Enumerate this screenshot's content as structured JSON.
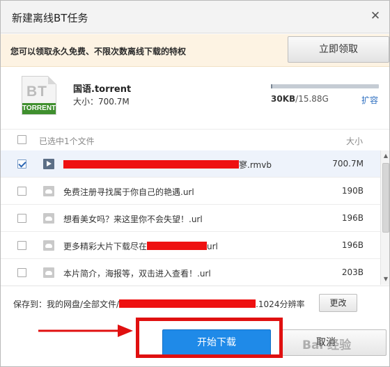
{
  "dialog": {
    "title": "新建离线BT任务",
    "close_icon": "close-icon"
  },
  "promo": {
    "text": "您可以领取永久免费、不限次数离线下载的特权",
    "claim_label": "立即领取"
  },
  "file": {
    "icon_letters": "BT",
    "icon_label": "TORRENT",
    "name": "国语.torrent",
    "size_text": "大小：700.7M"
  },
  "quota": {
    "used": "30KB",
    "total": "/15.88G",
    "fill_fraction": 0.01,
    "expand_label": "扩容"
  },
  "list_header": {
    "selected_label": "已选中1个文件",
    "size_label": "大小"
  },
  "files": [
    {
      "checked": true,
      "icon": "video-icon",
      "name_suffix": "寥.rmvb",
      "size": "700.7M",
      "redacted": true
    },
    {
      "checked": false,
      "icon": "cloud-icon",
      "name": "免费注册寻找属于你自己的艳遇.url",
      "size": "190B"
    },
    {
      "checked": false,
      "icon": "cloud-icon",
      "name": "想看美女吗？来这里你不会失望！.url",
      "size": "196B"
    },
    {
      "checked": false,
      "icon": "cloud-icon",
      "name_prefix": "更多精彩大片下载尽在",
      "name_suffix": "url",
      "size": "196B",
      "redacted": true
    },
    {
      "checked": false,
      "icon": "cloud-icon",
      "name": "本片简介，海报等，双击进入查看！.url",
      "size": "203B"
    }
  ],
  "save": {
    "prefix": "保存到：我的网盘/全部文件/",
    "suffix": ".1024分辨率",
    "change_label": "更改"
  },
  "footer": {
    "start_label": "开始下载",
    "cancel_label": "取消"
  },
  "watermark": "Bai 经验",
  "colors": {
    "primary": "#1f8ae8",
    "highlight": "#e01010",
    "promo_bg": "#fdf3e3"
  }
}
